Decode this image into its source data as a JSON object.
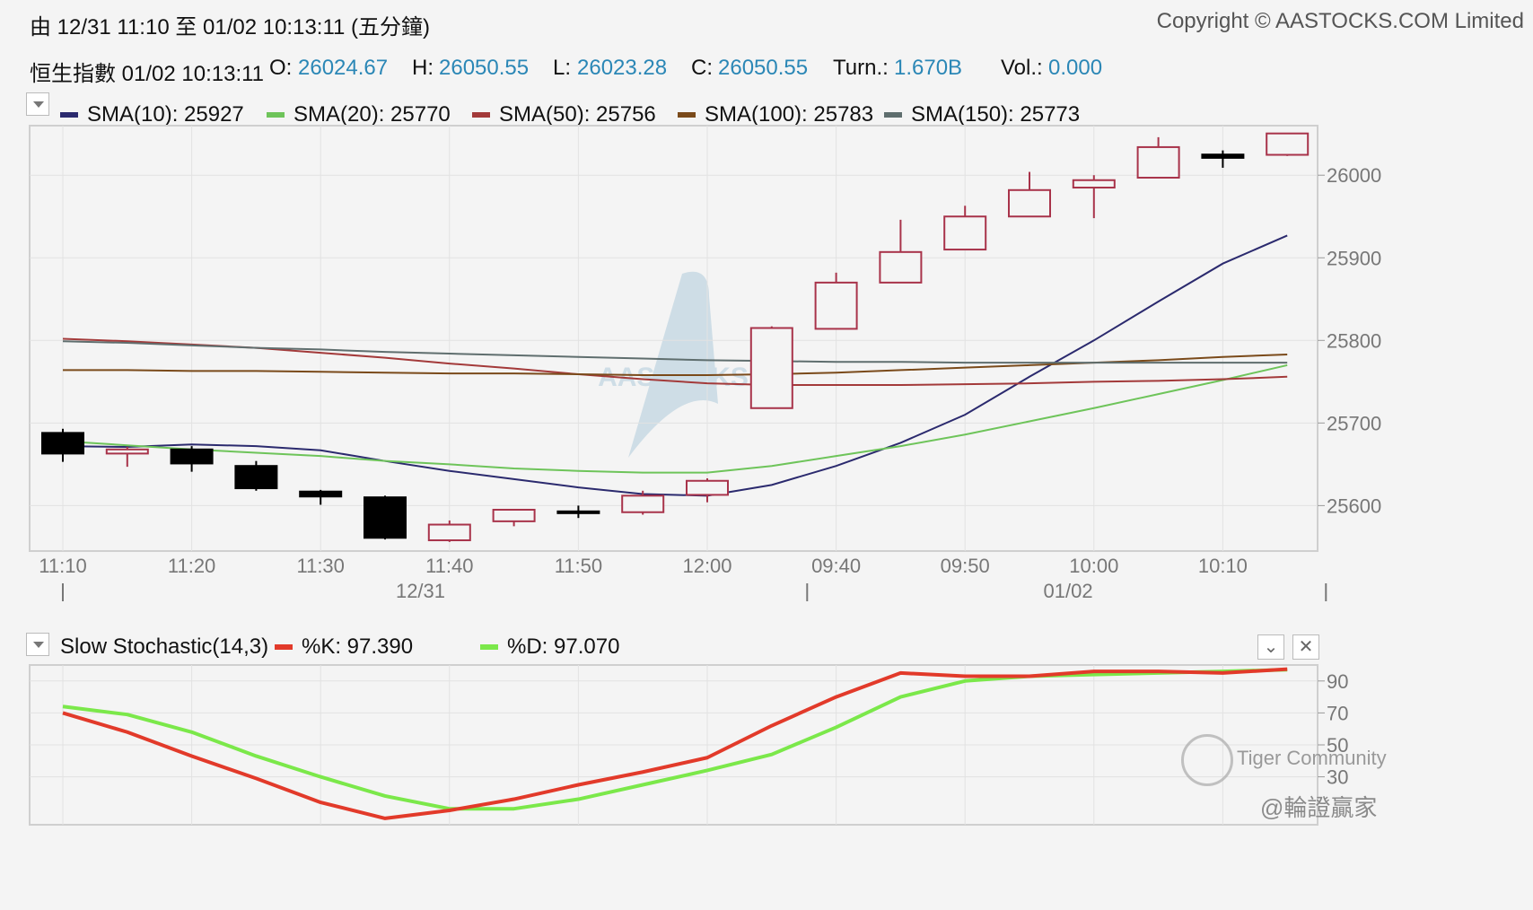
{
  "header": {
    "range_label": "由  12/31 11:10 至  01/02 10:13:11 (五分鐘)",
    "copyright": "Copyright © AASTOCKS.COM Limited"
  },
  "quote": {
    "name_time": "恒生指數 01/02 10:13:11",
    "o_label": "O:",
    "o_value": "26024.67",
    "h_label": "H:",
    "h_value": "26050.55",
    "l_label": "L:",
    "l_value": "26023.28",
    "c_label": "C:",
    "c_value": "26050.55",
    "turn_label": "Turn.:",
    "turn_value": "1.670B",
    "vol_label": "Vol.:",
    "vol_value": "0.000"
  },
  "legend": [
    {
      "label": "SMA(10): 25927",
      "color": "#2b2a6e"
    },
    {
      "label": "SMA(20): 25770",
      "color": "#6ec45a"
    },
    {
      "label": "SMA(50): 25756",
      "color": "#a33a3a"
    },
    {
      "label": "SMA(100): 25783",
      "color": "#7a4a1a"
    },
    {
      "label": "SMA(150): 25773",
      "color": "#5f6e6e"
    }
  ],
  "watermark": "AASTOCKS",
  "chart_data": [
    {
      "type": "candlestick",
      "x": [
        "11:10",
        "11:15",
        "11:20",
        "11:25",
        "11:30",
        "11:35",
        "11:40",
        "11:45",
        "11:50",
        "11:55",
        "12:00",
        "09:35",
        "09:40",
        "09:45",
        "09:50",
        "09:55",
        "10:00",
        "10:05",
        "10:10",
        "10:13"
      ],
      "x_tick_labels": [
        "11:10",
        "11:20",
        "11:30",
        "11:40",
        "11:50",
        "12:00",
        "09:40",
        "09:50",
        "10:00",
        "10:10"
      ],
      "date_labels": [
        "12/31",
        "01/02"
      ],
      "ylim": [
        25545,
        26060
      ],
      "y_ticks": [
        25600,
        25700,
        25800,
        25900,
        26000
      ],
      "ohlc": [
        [
          25688,
          25693,
          25653,
          25663
        ],
        [
          25663,
          25671,
          25647,
          25668
        ],
        [
          25668,
          25672,
          25641,
          25651
        ],
        [
          25648,
          25654,
          25618,
          25621
        ],
        [
          25617,
          25619,
          25601,
          25611
        ],
        [
          25610,
          25612,
          25559,
          25561
        ],
        [
          25558,
          25582,
          25556,
          25577
        ],
        [
          25581,
          25595,
          25575,
          25595
        ],
        [
          25593,
          25600,
          25585,
          25592
        ],
        [
          25592,
          25618,
          25589,
          25612
        ],
        [
          25613,
          25633,
          25604,
          25630
        ],
        [
          25718,
          25817,
          25718,
          25815
        ],
        [
          25814,
          25882,
          25814,
          25870
        ],
        [
          25870,
          25946,
          25870,
          25907
        ],
        [
          25910,
          25963,
          25910,
          25950
        ],
        [
          25950,
          26004,
          25950,
          25982
        ],
        [
          25985,
          26000,
          25948,
          25994
        ],
        [
          25997,
          26046,
          25997,
          26034
        ],
        [
          26025,
          26030,
          26009,
          26021
        ],
        [
          26024.67,
          26050.55,
          26023.28,
          26050.55
        ]
      ],
      "up_color": "#a8334a",
      "down_color": "#000000",
      "series": [
        {
          "name": "SMA(10)",
          "color": "#2b2a6e",
          "values": [
            25672,
            25671,
            25674,
            25672,
            25667,
            25654,
            25642,
            25632,
            25622,
            25614,
            25612,
            25625,
            25648,
            25676,
            25710,
            25756,
            25800,
            25847,
            25893,
            25927
          ]
        },
        {
          "name": "SMA(20)",
          "color": "#6ec45a",
          "values": [
            25678,
            25673,
            25668,
            25664,
            25660,
            25654,
            25650,
            25645,
            25642,
            25640,
            25640,
            25648,
            25660,
            25672,
            25686,
            25702,
            25718,
            25735,
            25752,
            25770
          ]
        },
        {
          "name": "SMA(50)",
          "color": "#a33a3a",
          "values": [
            25802,
            25799,
            25795,
            25791,
            25785,
            25779,
            25772,
            25766,
            25759,
            25753,
            25748,
            25746,
            25746,
            25746,
            25747,
            25748,
            25750,
            25751,
            25753,
            25756
          ]
        },
        {
          "name": "SMA(100)",
          "color": "#7a4a1a",
          "values": [
            25764,
            25764,
            25763,
            25763,
            25762,
            25761,
            25760,
            25760,
            25759,
            25758,
            25758,
            25759,
            25761,
            25764,
            25767,
            25770,
            25773,
            25776,
            25780,
            25783
          ]
        },
        {
          "name": "SMA(150)",
          "color": "#5f6e6e",
          "values": [
            25799,
            25797,
            25794,
            25791,
            25789,
            25786,
            25784,
            25782,
            25780,
            25778,
            25776,
            25775,
            25774,
            25774,
            25773,
            25773,
            25773,
            25773,
            25773,
            25773
          ]
        }
      ]
    },
    {
      "type": "line",
      "indicator": "Slow Stochastic(14,3)",
      "legend_k": "%K: 97.390",
      "legend_d": "%D: 97.070",
      "ylim": [
        0,
        100
      ],
      "y_ticks": [
        30,
        50,
        70,
        90
      ],
      "series": [
        {
          "name": "%K",
          "color": "#e23a2a",
          "values": [
            70,
            58,
            43,
            29,
            14,
            4,
            9,
            16,
            25,
            33,
            42,
            62,
            80,
            95,
            93,
            93,
            96,
            96,
            95,
            97.39
          ]
        },
        {
          "name": "%D",
          "color": "#7be84a",
          "values": [
            74,
            69,
            58,
            43,
            30,
            18,
            10,
            10,
            16,
            25,
            34,
            44,
            61,
            80,
            90,
            93,
            94,
            95,
            96,
            97.07
          ]
        }
      ]
    }
  ],
  "stoch_header": {
    "title": "Slow Stochastic(14,3)",
    "k_label": "%K: 97.390",
    "k_color": "#e23a2a",
    "d_label": "%D: 97.070",
    "d_color": "#7be84a"
  },
  "footer": {
    "community": "Tiger Community",
    "handle": "@輪證贏家"
  }
}
